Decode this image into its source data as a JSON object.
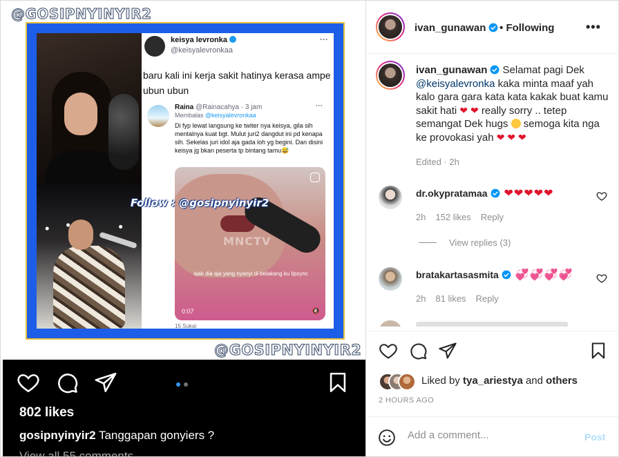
{
  "media": {
    "watermark_top": "@GOSIPNYINYIR2",
    "watermark_bottom": "@GOSIPNYINYIR2",
    "follow_watermark": "Follow : @gosipnyinyir2",
    "tweet": {
      "name": "keisya levronka",
      "handle": "@keisyalevronkaa",
      "text": "baru kali ini kerja sakit hatinya kerasa ampe ubun ubun",
      "reply": {
        "name": "Raina",
        "handle_time": "@Rainacahya · 3 jam",
        "replying_prefix": "Membalas",
        "replying_to": "@keisyalevronkaa",
        "text": "Di fyp lewat langsung ke twiter nya keisya, gila sih mentalnya kuat bgt. Mulut juri2 dangdut ini pd kenapa sih. Sekelas juri idol aja gada loh yg begini. Dan disini keisya jg bkan peserta tp bintang tamu😅",
        "video_logo": "MNCTV",
        "video_caption": "ajak dia aja yang nyanyi di belakang ku lipsync",
        "video_time": "0:07",
        "footer": "15 Sukai"
      }
    }
  },
  "dark_bar": {
    "likes": "802 likes",
    "caption_user": "gosipnyinyir2",
    "caption_text": "Tanggapan gonyiers ?",
    "view_all": "View all 55 comments",
    "carousel_dots": 2
  },
  "header": {
    "username": "ivan_gunawan",
    "separator": "•",
    "follow_state": "Following",
    "more": "•••"
  },
  "caption": {
    "username": "ivan_gunawan",
    "text_1": "Selamat pagi Dek",
    "mention": "@keisyalevronka",
    "text_2": "kaka minta maaf yah kalo gara gara kata kata kakak buat kamu sakit hati",
    "hearts_1": "❤ ❤",
    "text_3": "really sorry .. tetep semangat Dek hugs",
    "text_4": "semoga kita nga ke provokasi yah",
    "hearts_2": "❤ ❤ ❤",
    "edited": "Edited · 2h"
  },
  "comments": [
    {
      "username": "dr.okypratamaa",
      "hearts": "❤❤❤❤❤",
      "time": "2h",
      "likes": "152 likes",
      "reply": "Reply",
      "view_replies": "View replies (3)"
    },
    {
      "username": "bratakartasasmita",
      "hearts": "💞💞💞💞",
      "time": "2h",
      "likes": "81 likes",
      "reply": "Reply"
    }
  ],
  "actions": {
    "liked_by_prefix": "Liked by",
    "liked_by_user": "tya_ariestya",
    "liked_by_and": "and",
    "liked_by_others": "others",
    "time_ago": "2 HOURS AGO"
  },
  "add_comment": {
    "placeholder": "Add a comment...",
    "post_label": "Post"
  },
  "colors": {
    "heart_red": "#e0142b",
    "verified_blue": "#0095f6",
    "post_disabled": "#b2dffc",
    "frame_blue": "#1d5ee8",
    "frame_gold": "#e6c03b"
  }
}
